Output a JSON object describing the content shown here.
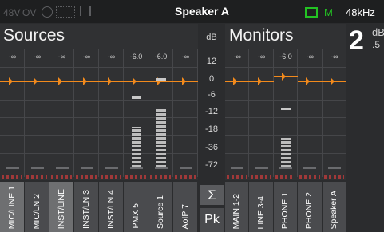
{
  "status": {
    "phantom": "48V",
    "ov": "OV",
    "title": "Speaker A",
    "mode": "M",
    "sample_rate": "48kHz"
  },
  "sources": {
    "title": "Sources",
    "channels": [
      {
        "name": "MIC/LINE 1",
        "top_value": "-∞",
        "level": 0,
        "selected": true
      },
      {
        "name": "MIC/LN 2",
        "top_value": "-∞",
        "level": 0,
        "selected": false
      },
      {
        "name": "INST/LINE",
        "top_value": "-∞",
        "level": 0,
        "selected": true
      },
      {
        "name": "INST/LN 3",
        "top_value": "-∞",
        "level": 0,
        "selected": false
      },
      {
        "name": "INST/LN 4",
        "top_value": "-∞",
        "level": 0,
        "selected": false
      },
      {
        "name": "PMX 5",
        "top_value": "-6.0",
        "level": 0.55,
        "selected": false
      },
      {
        "name": "Source 1",
        "top_value": "-6.0",
        "level": 0.8,
        "selected": false
      },
      {
        "name": "AoIP 7",
        "top_value": "-∞",
        "level": 0,
        "selected": false
      }
    ]
  },
  "scale": {
    "unit": "dB",
    "ticks": [
      "12",
      "0",
      "-6",
      "-12",
      "-18",
      "-36",
      "-72"
    ]
  },
  "center_buttons": {
    "sum": "Σ",
    "peak": "Pk"
  },
  "monitors": {
    "title": "Monitors",
    "channels": [
      {
        "name": "MAIN 1-2",
        "top_value": "-∞",
        "level": 0
      },
      {
        "name": "LINE 3-4",
        "top_value": "-∞",
        "level": 0
      },
      {
        "name": "PHONE 1",
        "top_value": "-6.0",
        "level": 0.4
      },
      {
        "name": "PHONE 2",
        "top_value": "-∞",
        "level": 0
      },
      {
        "name": "Speaker A",
        "top_value": "-∞",
        "level": 0
      }
    ]
  },
  "big_value": {
    "digit": "2",
    "unit": "dB",
    "decimal": ".5"
  }
}
